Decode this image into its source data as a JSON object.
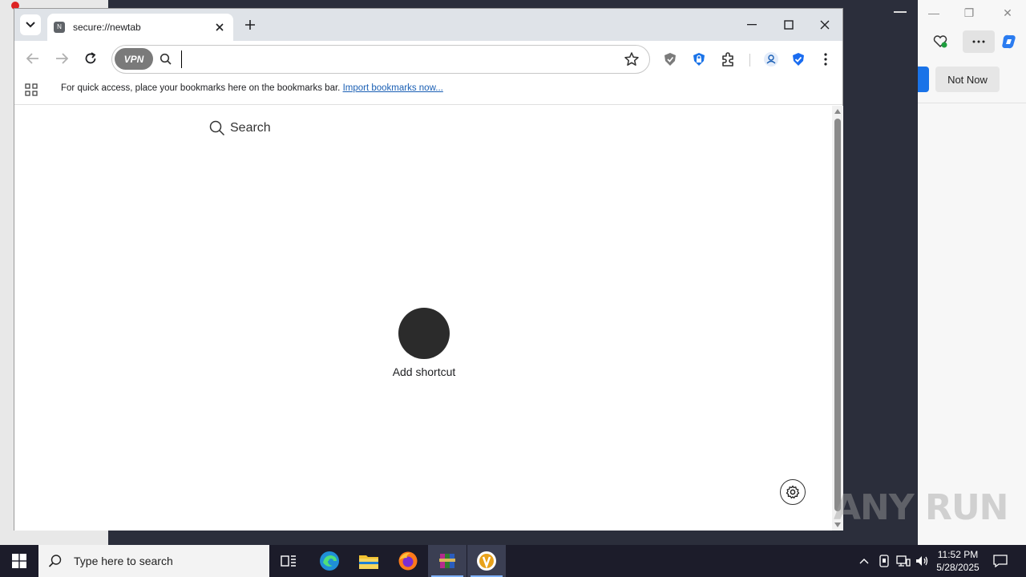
{
  "browser": {
    "tab_title": "secure://newtab",
    "tab_favicon_letter": "N",
    "omnibox": {
      "value": "",
      "placeholder": ""
    },
    "vpn_label": "VPN",
    "bookmarks_bar": {
      "message": "For quick access, place your bookmarks here on the bookmarks bar.",
      "link": "Import bookmarks now..."
    },
    "ntp": {
      "search_label": "Search",
      "shortcut_label": "Add shortcut"
    }
  },
  "edge_background": {
    "not_now_label": "Not Now"
  },
  "watermark": "ANY RUN",
  "taskbar": {
    "search_placeholder": "Type here to search",
    "time": "11:52 PM",
    "date": "5/28/2025"
  },
  "colors": {
    "taskbar": "#1c1c2a",
    "tabstrip": "#dfe3e8",
    "link": "#1a5fb4",
    "shortcut_circle": "#2b2b2b"
  }
}
